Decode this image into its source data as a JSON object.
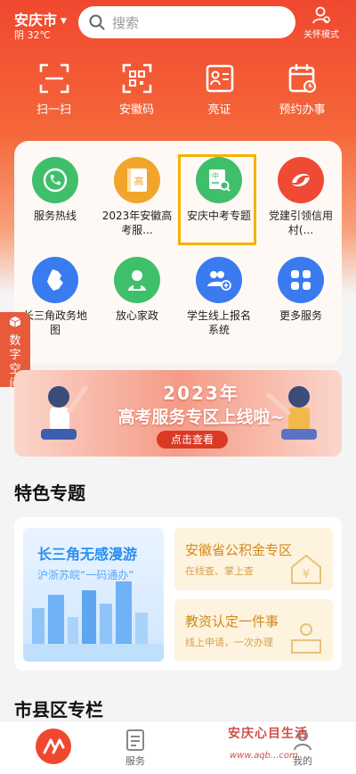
{
  "header": {
    "city": "安庆市",
    "weather": "阴 32℃",
    "search_placeholder": "搜索",
    "care_mode": "关怀模式"
  },
  "quick_actions": [
    {
      "label": "扫一扫",
      "icon": "scan-icon"
    },
    {
      "label": "安徽码",
      "icon": "qr-code-icon"
    },
    {
      "label": "亮证",
      "icon": "id-card-icon"
    },
    {
      "label": "预约办事",
      "icon": "calendar-clock-icon"
    }
  ],
  "services": [
    {
      "label": "服务热线",
      "icon": "phone-icon",
      "color": "#3fbf6a"
    },
    {
      "label": "2023年安徽高考服...",
      "icon": "gaokao-book-icon",
      "color": "#f2a52b"
    },
    {
      "label": "安庆中考专题",
      "icon": "zhongkao-search-icon",
      "color": "#3fbf6a"
    },
    {
      "label": "党建引领信用村(...",
      "icon": "party-logo-icon",
      "color": "#ef4a34"
    },
    {
      "label": "长三角政务地图",
      "icon": "map-icon",
      "color": "#3a7bf0"
    },
    {
      "label": "放心家政",
      "icon": "housekeeper-icon",
      "color": "#3fbf6a"
    },
    {
      "label": "学生线上报名系统",
      "icon": "student-add-icon",
      "color": "#3a7bf0"
    },
    {
      "label": "更多服务",
      "icon": "grid-more-icon",
      "color": "#3a7bf0"
    }
  ],
  "side_tab": {
    "label": "数字空间"
  },
  "banner": {
    "line1": "2023年",
    "line2": "高考服务专区上线啦~",
    "button": "点击查看"
  },
  "featured": {
    "title": "特色专题",
    "left": {
      "title": "长三角无感漫游",
      "subtitle": "沪浙苏皖“一码通办”"
    },
    "right_top": {
      "title": "安徽省公积金专区",
      "subtitle": "在线查、掌上查"
    },
    "right_bottom": {
      "title": "教资认定一件事",
      "subtitle": "线上申请，一次办理"
    }
  },
  "county_section": {
    "title": "市县区专栏"
  },
  "tabbar": {
    "tabs": [
      {
        "label": "",
        "icon": "home-logo-icon"
      },
      {
        "label": "服务",
        "icon": "service-doc-icon"
      },
      {
        "label": "我的",
        "icon": "user-icon"
      }
    ]
  },
  "watermark": {
    "text": "安庆心目生活",
    "url": "www.aqb...com"
  },
  "colors": {
    "brand": "#f0482f",
    "accent_highlight": "#f4b200",
    "blue": "#3a7bf0",
    "green": "#3fbf6a",
    "orange": "#f2a52b"
  }
}
